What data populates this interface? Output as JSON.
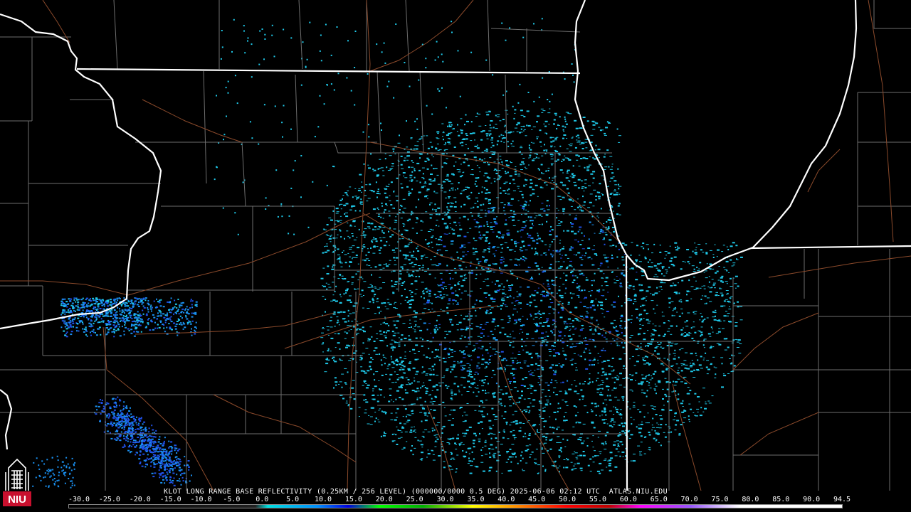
{
  "caption": "KLOT LONG RANGE BASE REFLECTIVITY (0.25KM / 256 LEVEL) (000000/0000 0.5 DEG) 2025-06-06 02:12 UTC  ATLAS.NIU.EDU",
  "logo": {
    "text": "NIU",
    "color": "#c8102e"
  },
  "scale": {
    "labels": [
      "-30.0",
      "-25.0",
      "-20.0",
      "-15.0",
      "-10.0",
      "-5.0",
      "0.0",
      "5.0",
      "10.0",
      "15.0",
      "20.0",
      "25.0",
      "30.0",
      "35.0",
      "40.0",
      "45.0",
      "50.0",
      "55.0",
      "60.0",
      "65.0",
      "70.0",
      "75.0",
      "80.0",
      "85.0",
      "90.0",
      "94.5"
    ],
    "stops": [
      {
        "dbz": -30,
        "color": "#000000"
      },
      {
        "dbz": 0,
        "color": "#202020"
      },
      {
        "dbz": 2,
        "color": "#00e0e0"
      },
      {
        "dbz": 10,
        "color": "#0090ff"
      },
      {
        "dbz": 15,
        "color": "#0000e0"
      },
      {
        "dbz": 20,
        "color": "#00ff00"
      },
      {
        "dbz": 27,
        "color": "#00b000"
      },
      {
        "dbz": 35,
        "color": "#ffff00"
      },
      {
        "dbz": 42,
        "color": "#ff9000"
      },
      {
        "dbz": 50,
        "color": "#ff0000"
      },
      {
        "dbz": 57,
        "color": "#c00000"
      },
      {
        "dbz": 62,
        "color": "#ff00ff"
      },
      {
        "dbz": 70,
        "color": "#9955ff"
      },
      {
        "dbz": 78,
        "color": "#ffffff"
      },
      {
        "dbz": 94.5,
        "color": "#ffffff"
      }
    ]
  },
  "colors": {
    "background": "#000000",
    "state_border": "#ffffff",
    "county_line": "#6e6e6e",
    "highway": "#8b4a2b",
    "echo_light": "#1fc8e8",
    "echo_mid": "#1a90f0",
    "echo_strong": "#2050e8"
  }
}
